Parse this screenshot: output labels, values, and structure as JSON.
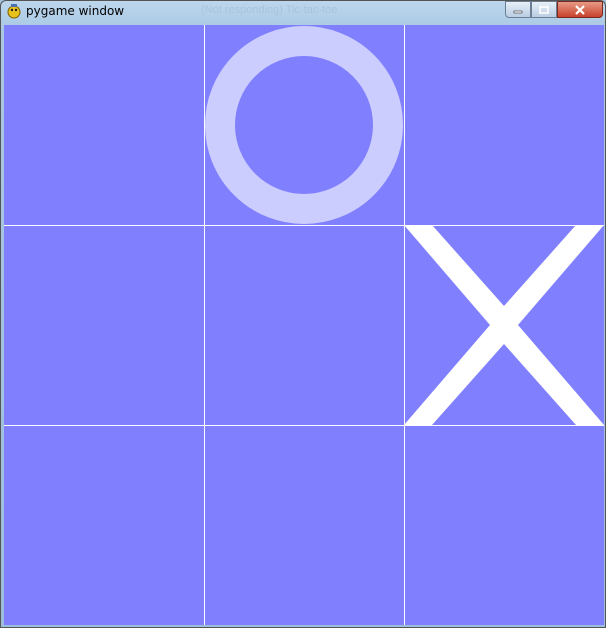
{
  "window": {
    "title": "pygame window",
    "ghost_title": "(Not responding) Tic-tac-toe"
  },
  "icons": {
    "app": "pygame-snake-icon",
    "minimize": "minimize-icon",
    "maximize": "maximize-icon",
    "close": "close-icon"
  },
  "colors": {
    "board_bg": "#8080ff",
    "grid_line": "#ffffff",
    "mark_o": "#cccdff",
    "mark_x": "#ffffff"
  },
  "board": {
    "cells": [
      "",
      "O",
      "",
      "",
      "",
      "X",
      "",
      "",
      ""
    ]
  }
}
